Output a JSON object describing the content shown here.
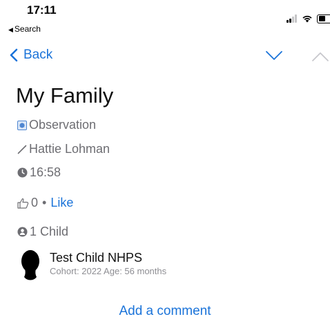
{
  "status_bar": {
    "time": "17:11",
    "back_app": "Search"
  },
  "nav": {
    "back_label": "Back"
  },
  "observation": {
    "title": "My Family",
    "type": "Observation",
    "author": "Hattie Lohman",
    "time": "16:58",
    "like_count": "0",
    "like_label": "Like",
    "child_count": "1 Child"
  },
  "child": {
    "name": "Test Child NHPS",
    "details": "Cohort: 2022 Age: 56 months"
  },
  "comment": {
    "add_label": "Add a comment"
  },
  "colors": {
    "accent": "#1a73d9",
    "muted": "#6d6d72",
    "type_badge": "#4f86d1"
  }
}
